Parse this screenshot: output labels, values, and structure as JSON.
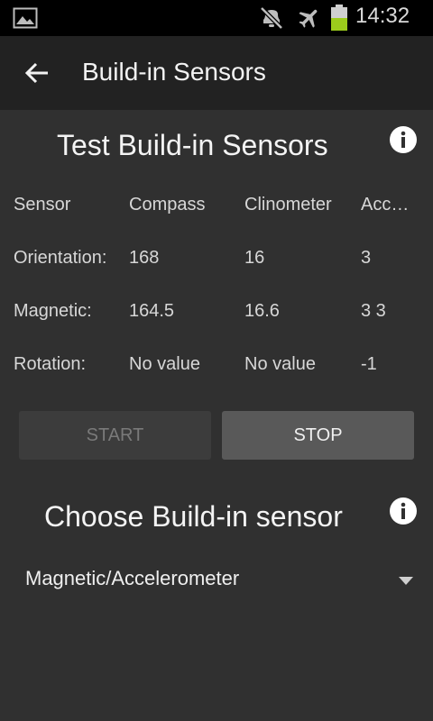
{
  "status_bar": {
    "time": "14:32",
    "icons": [
      "image-icon",
      "mute-icon",
      "airplane-mode-icon",
      "battery-icon"
    ],
    "battery_color": "#9ccc1c"
  },
  "app_bar": {
    "back_icon": "back-arrow-icon",
    "title": "Build-in Sensors"
  },
  "test_section": {
    "title": "Test Build-in Sensors",
    "info_icon": "info-icon"
  },
  "table": {
    "headers": [
      "Sensor",
      "Compass",
      "Clinometer",
      "Accuracy"
    ],
    "rows": [
      {
        "label": "Orientation:",
        "compass": "168",
        "clinometer": "16",
        "accuracy": "3"
      },
      {
        "label": "Magnetic:",
        "compass": "164.5",
        "clinometer": "16.6",
        "accuracy": "3 3"
      },
      {
        "label": "Rotation:",
        "compass": "No value",
        "clinometer": "No value",
        "accuracy": "-1"
      }
    ]
  },
  "buttons": {
    "start_label": "START",
    "stop_label": "STOP"
  },
  "choose_section": {
    "title": "Choose Build-in sensor",
    "info_icon": "info-icon"
  },
  "sensor_select": {
    "selected": "Magnetic/Accelerometer"
  },
  "colors": {
    "background": "#303030",
    "app_bar": "#222222",
    "status_bar": "#000000",
    "button_disabled": "#3c3c3c",
    "button_active": "#595959"
  }
}
